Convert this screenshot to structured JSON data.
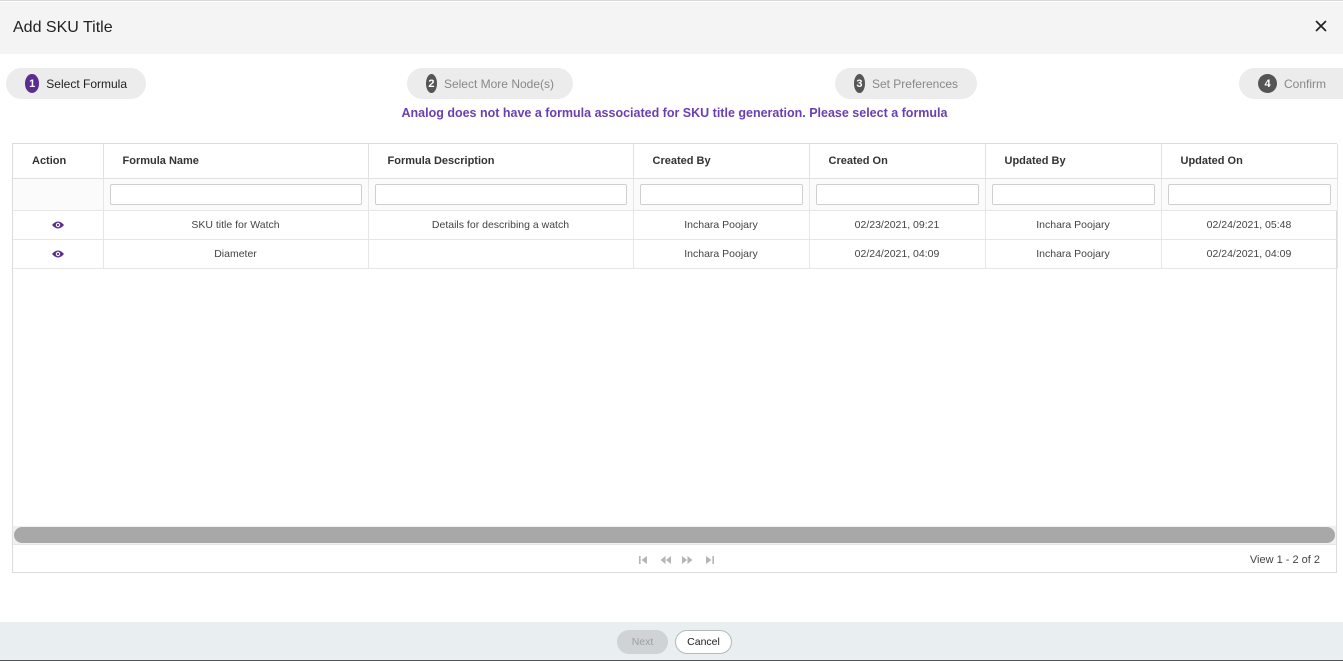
{
  "dialog": {
    "title": "Add SKU Title",
    "close_icon": "close-icon"
  },
  "steps": [
    {
      "number": "1",
      "label": "Select Formula",
      "active": true
    },
    {
      "number": "2",
      "label": "Select More Node(s)",
      "active": false
    },
    {
      "number": "3",
      "label": "Set Preferences",
      "active": false
    },
    {
      "number": "4",
      "label": "Confirm",
      "active": false
    }
  ],
  "notice": "Analog does not have a formula associated for SKU title generation. Please select a formula",
  "grid": {
    "columns": [
      "Action",
      "Formula Name",
      "Formula Description",
      "Created By",
      "Created On",
      "Updated By",
      "Updated On"
    ],
    "rows": [
      {
        "action_icon": "eye-icon",
        "formula_name": "SKU title for Watch",
        "formula_description": "Details for describing a watch",
        "created_by": "Inchara Poojary",
        "created_on": "02/23/2021, 09:21",
        "updated_by": "Inchara Poojary",
        "updated_on": "02/24/2021, 05:48"
      },
      {
        "action_icon": "eye-icon",
        "formula_name": "Diameter",
        "formula_description": "",
        "created_by": "Inchara Poojary",
        "created_on": "02/24/2021, 04:09",
        "updated_by": "Inchara Poojary",
        "updated_on": "02/24/2021, 04:09"
      }
    ],
    "pager": {
      "icons": [
        "first-page-icon",
        "prev-page-icon",
        "next-page-icon",
        "last-page-icon"
      ],
      "count_text": "View 1 - 2 of 2"
    }
  },
  "footer": {
    "next_label": "Next",
    "cancel_label": "Cancel"
  },
  "colors": {
    "accent": "#5b2d8e",
    "notice": "#6a3fb1",
    "footer_bg": "#e9eef0"
  }
}
